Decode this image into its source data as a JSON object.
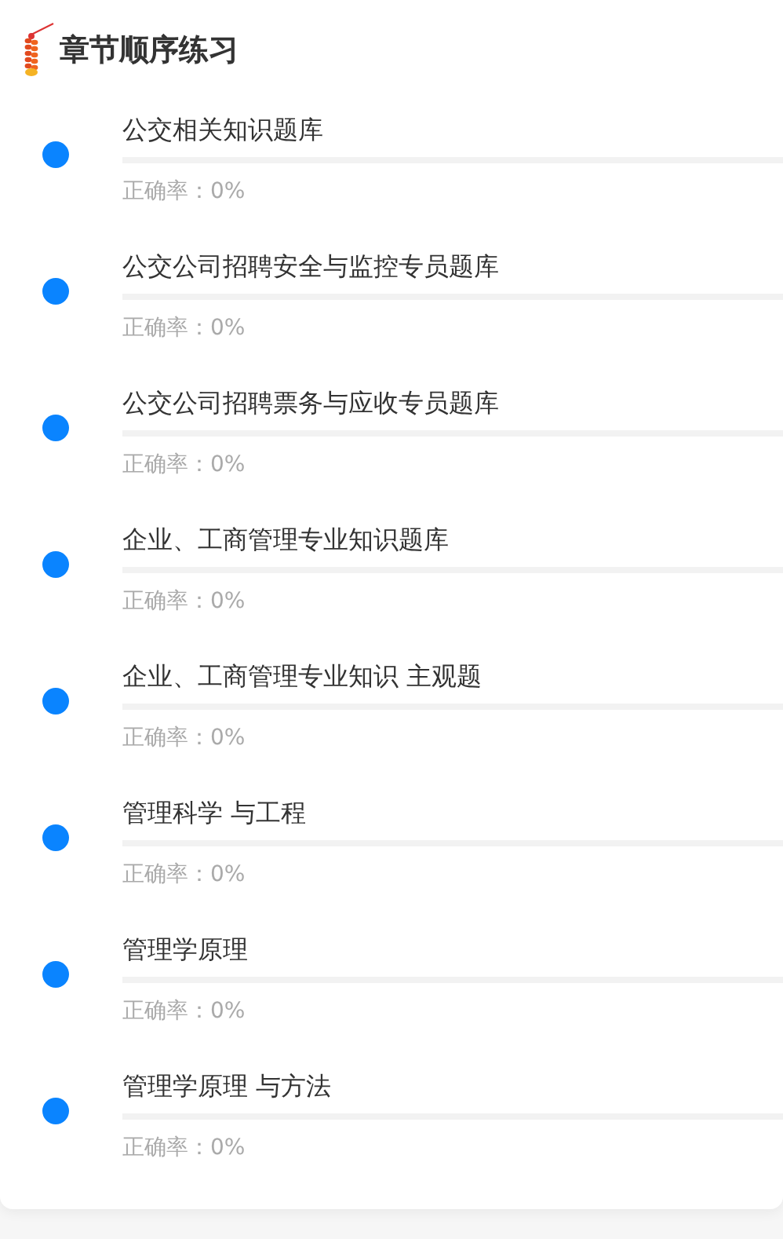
{
  "header": {
    "title": "章节顺序练习"
  },
  "chapters": [
    {
      "title": "公交相关知识题库",
      "accuracy": "正确率：0%"
    },
    {
      "title": "公交公司招聘安全与监控专员题库",
      "accuracy": "正确率：0%"
    },
    {
      "title": "公交公司招聘票务与应收专员题库",
      "accuracy": "正确率：0%"
    },
    {
      "title": "企业、工商管理专业知识题库",
      "accuracy": "正确率：0%"
    },
    {
      "title": "企业、工商管理专业知识 主观题",
      "accuracy": "正确率：0%"
    },
    {
      "title": "管理科学 与工程",
      "accuracy": "正确率：0%"
    },
    {
      "title": "管理学原理",
      "accuracy": "正确率：0%"
    },
    {
      "title": "管理学原理 与方法",
      "accuracy": "正确率：0%"
    }
  ]
}
